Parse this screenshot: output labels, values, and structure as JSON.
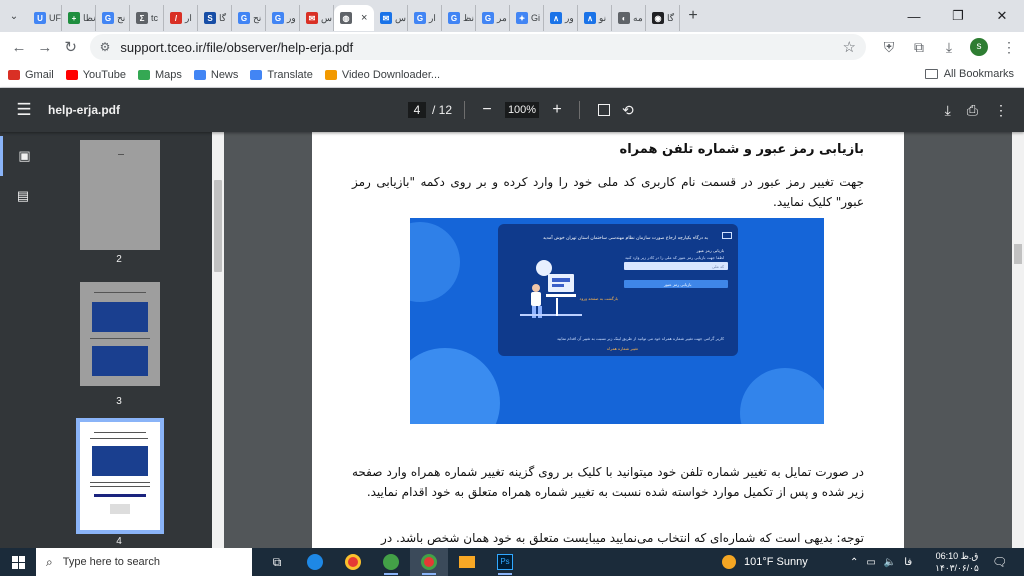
{
  "browser": {
    "tabs": [
      {
        "label": "UF",
        "color": "#4285f4",
        "glyph": "U"
      },
      {
        "label": "نظا",
        "color": "#1e8e3e",
        "glyph": "+"
      },
      {
        "label": "نح",
        "color": "#4285f4",
        "glyph": "G"
      },
      {
        "label": "tc",
        "color": "#5f6368",
        "glyph": "Σ"
      },
      {
        "label": "ار",
        "color": "#d93025",
        "glyph": "/"
      },
      {
        "label": "گا",
        "color": "#174ea6",
        "glyph": "S"
      },
      {
        "label": "نح",
        "color": "#4285f4",
        "glyph": "G"
      },
      {
        "label": "ور",
        "color": "#4285f4",
        "glyph": "G"
      },
      {
        "label": "س",
        "color": "#d93025",
        "glyph": "✉"
      },
      {
        "label": "س",
        "color": "#1a73e8",
        "glyph": "✉"
      },
      {
        "label": "ار",
        "color": "#4285f4",
        "glyph": "G"
      },
      {
        "label": "نظ",
        "color": "#4285f4",
        "glyph": "G"
      },
      {
        "label": "مر",
        "color": "#4285f4",
        "glyph": "G"
      },
      {
        "label": "Gi",
        "color": "#4285f4",
        "glyph": "✦"
      },
      {
        "label": "ور",
        "color": "#1a73e8",
        "glyph": "∧"
      },
      {
        "label": "نو",
        "color": "#1a73e8",
        "glyph": "∧"
      },
      {
        "label": "مه",
        "color": "#5f6368",
        "glyph": "◐"
      },
      {
        "label": "گا",
        "color": "#202124",
        "glyph": "◉"
      }
    ],
    "active_tab_close": "×",
    "new_tab": "+",
    "url": "support.tceo.ir/file/observer/help-erja.pdf",
    "avatar_letter": "s",
    "bookmarks": [
      {
        "label": "Gmail",
        "color": "#d93025"
      },
      {
        "label": "YouTube",
        "color": "#ff0000"
      },
      {
        "label": "Maps",
        "color": "#34a853"
      },
      {
        "label": "News",
        "color": "#4285f4"
      },
      {
        "label": "Translate",
        "color": "#4285f4"
      },
      {
        "label": "Video Downloader...",
        "color": "#f29900"
      }
    ],
    "all_bookmarks": "All Bookmarks"
  },
  "pdf": {
    "filename": "help-erja.pdf",
    "current_page": "4",
    "total_pages": "/ 12",
    "zoom": "100%",
    "thumbnails": [
      "2",
      "3",
      "4"
    ],
    "heading": "بازیابی رمز عبور و شماره تلفن همراه",
    "para1": "جهت تغییر رمز عبور در قسمت نام کاربری کد ملی خود را وارد کرده و بر روی دکمه \"بازیابی رمز عبور\" کلیک نمایید.",
    "para2": "در صورت تمایل به تغییر شماره تلفن خود میتوانید با کلیک بر روی گزینه تغییر شماره همراه وارد صفحه زیر شده و پس از تکمیل موارد خواسته شده نسبت به تغییر شماره همراه متعلق به خود اقدام نمایید.",
    "para3": "توجه: بدیهی است که شماره‌ای که انتخاب می‌نمایید میبایست متعلق به خود همان شخص باشد. در",
    "screenshot": {
      "welcome": "به درگاه یکپارچه ارجاع صورت سازمان نظام مهندسی ساختمان استان تهران خوش آمدید",
      "form_title": "بازیابی رمز عبور",
      "form_hint": "لطفا جهت بازیابی رمز عبور کد ملی را در کادر زیر وارد کنید",
      "input_placeholder": "کد ملی",
      "button": "بازیابی رمز عبور",
      "back_link": "بازگشت به صفحه ورود",
      "footer_note": "کاربر گرامی جهت تغییر شماره همراه خود می توانید از طریق لینک زیر نسبت به تغییر آن اقدام نمایید",
      "change_link": "تغییر شماره همراه"
    }
  },
  "taskbar": {
    "search_placeholder": "Type here to search",
    "weather_temp": "101°F",
    "weather_text": "Sunny",
    "lang": "فا",
    "time": "ق.ظ 06:10",
    "date": "۱۴۰۳/۰۶/۰۵"
  }
}
